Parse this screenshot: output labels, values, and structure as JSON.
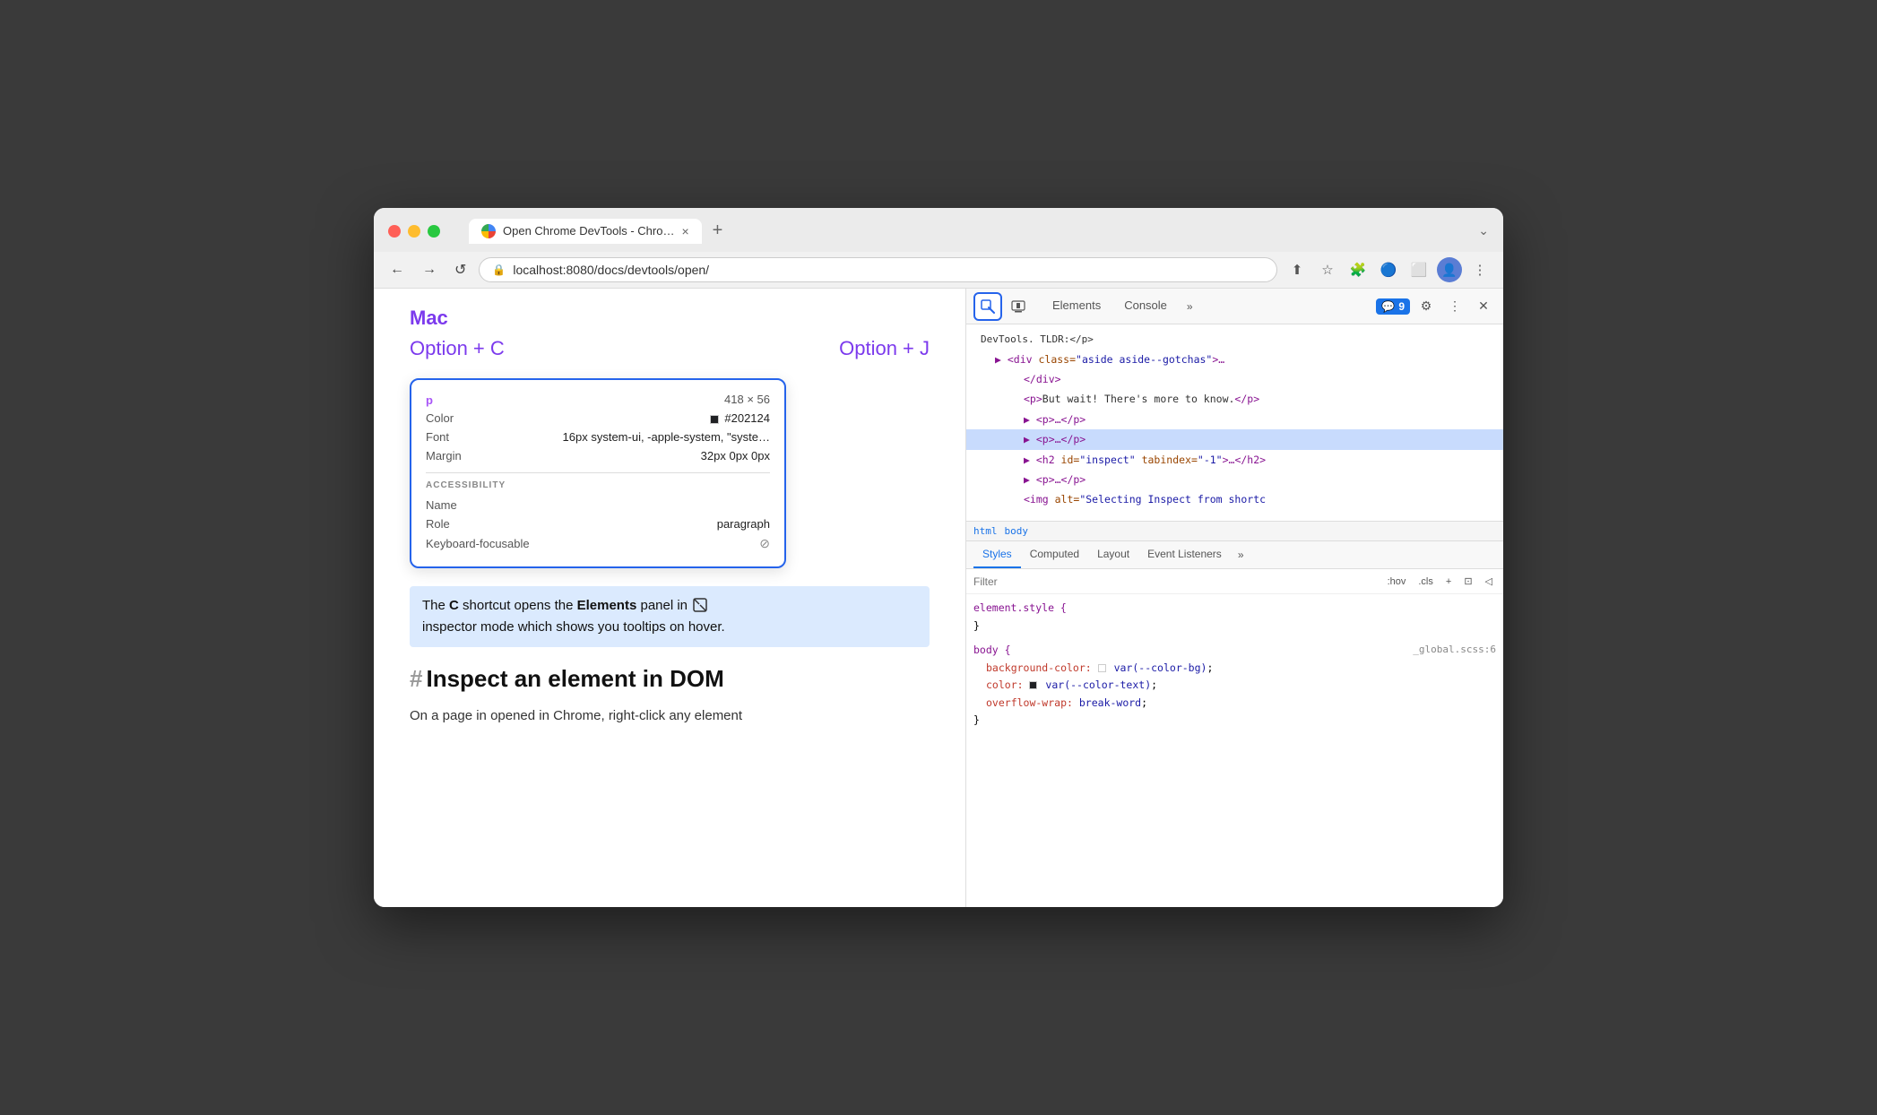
{
  "browser": {
    "tab_title": "Open Chrome DevTools - Chro…",
    "url": "localhost:8080/docs/devtools/open/",
    "tab_close": "×",
    "tab_new": "+",
    "tab_more": "⌄"
  },
  "nav": {
    "back": "←",
    "forward": "→",
    "reload": "↺",
    "more_options": "⋮"
  },
  "webpage": {
    "mac_label": "Mac",
    "shortcut_c": "Option + C",
    "shortcut_j": "Option + J",
    "tooltip": {
      "tag": "p",
      "dimensions": "418 × 56",
      "color_label": "Color",
      "color_value": "#202124",
      "font_label": "Font",
      "font_value": "16px system-ui, -apple-system, \"syste…",
      "margin_label": "Margin",
      "margin_value": "32px 0px 0px",
      "accessibility_heading": "ACCESSIBILITY",
      "name_label": "Name",
      "name_value": "",
      "role_label": "Role",
      "role_value": "paragraph",
      "keyboard_label": "Keyboard-focusable",
      "keyboard_value": "⊘"
    },
    "highlighted_text_1": "The ",
    "highlighted_bold_c": "C",
    "highlighted_text_2": " shortcut opens the ",
    "highlighted_bold_elements": "Elements",
    "highlighted_text_3": " panel in",
    "highlighted_text_4": "inspector mode which shows you tooltips on hover.",
    "section_hash": "#",
    "section_title": "Inspect an element in DOM",
    "body_text": "On a page in opened in Chrome, right-click any element"
  },
  "devtools": {
    "panels": {
      "elements_label": "Elements",
      "console_label": "Console",
      "more_label": "»"
    },
    "badge": {
      "icon": "💬",
      "count": "9"
    },
    "actions": {
      "settings": "⚙",
      "more": "⋮",
      "close": "✕"
    },
    "tree": {
      "lines": [
        {
          "indent": 0,
          "content": "DevTools. TLDR:</p>"
        },
        {
          "indent": 1,
          "content": "▶ <div class=\"aside aside--gotchas\">…"
        },
        {
          "indent": 2,
          "content": "</div>"
        },
        {
          "indent": 2,
          "content": "<p>But wait! There's more to know.</p>"
        },
        {
          "indent": 2,
          "content": "▶ <p>…</p>"
        },
        {
          "indent": 2,
          "content": "▶ <p>…</p>",
          "selected": true
        },
        {
          "indent": 2,
          "content": "▶ <h2 id=\"inspect\" tabindex=\"-1\">…</h2>"
        },
        {
          "indent": 2,
          "content": "▶ <p>…</p>"
        },
        {
          "indent": 2,
          "content": "<img alt=\"Selecting Inspect from shortc"
        }
      ]
    },
    "breadcrumbs": [
      "html",
      "body"
    ],
    "styles": {
      "tabs": [
        "Styles",
        "Computed",
        "Layout",
        "Event Listeners",
        "»"
      ],
      "active_tab": "Styles",
      "filter_placeholder": "Filter",
      "filter_actions": [
        ":hov",
        ".cls",
        "+",
        "⊡",
        "◁"
      ],
      "blocks": [
        {
          "selector": "element.style {",
          "close": "}",
          "rules": []
        },
        {
          "selector": "body {",
          "source": "_global.scss:6",
          "close": "}",
          "rules": [
            {
              "prop": "background-color:",
              "swatch": "white",
              "value": "var(--color-bg);"
            },
            {
              "prop": "color:",
              "swatch": "dark",
              "value": "var(--color-text);"
            },
            {
              "prop": "overflow-wrap:",
              "value": "break-word;"
            }
          ]
        }
      ]
    }
  }
}
